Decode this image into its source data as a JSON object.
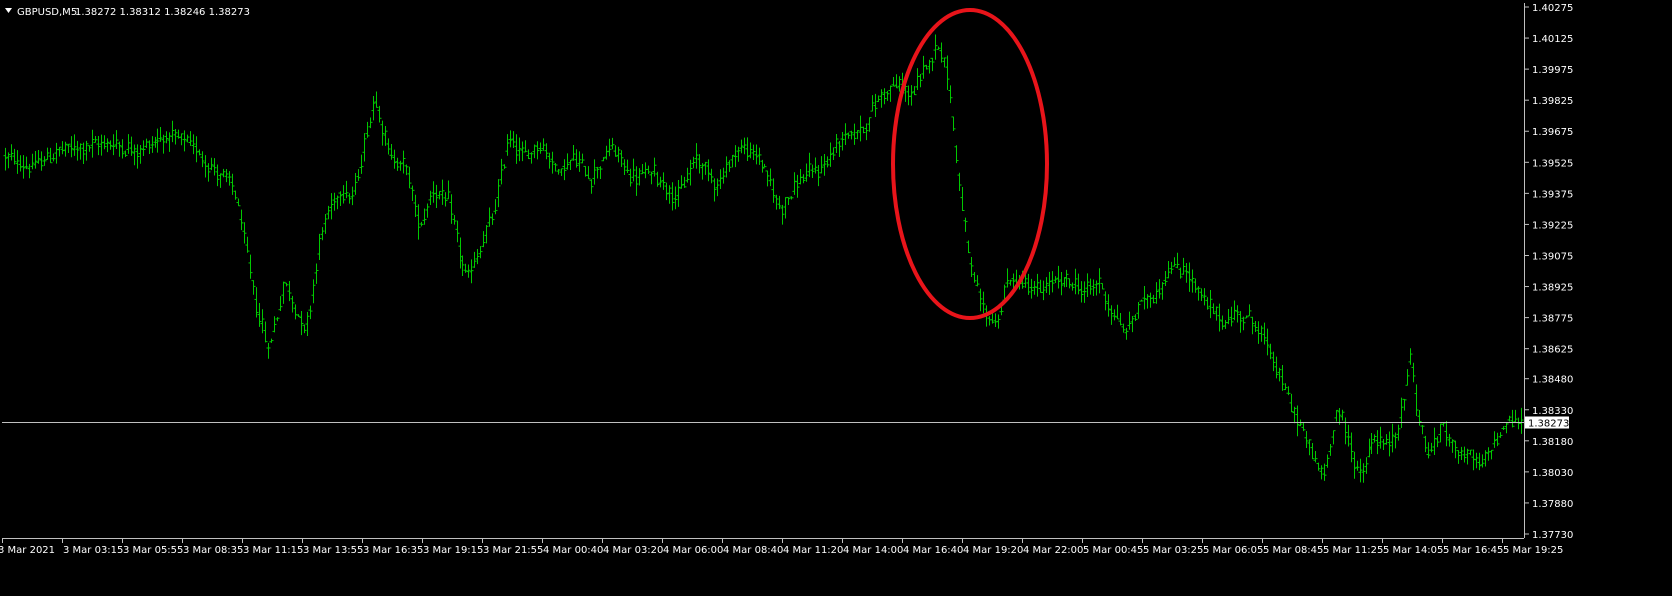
{
  "symbol_info": {
    "symbol": "GBPUSD,M5",
    "ohlc": "1.38272 1.38312 1.38246 1.38273"
  },
  "colors": {
    "background": "#000000",
    "bars": "#00c800",
    "axis": "#c0c0c0",
    "text": "#ffffff",
    "current_price_line": "#c0c0c0",
    "current_price_tag_bg": "#ffffff",
    "annotation": "#e8141a"
  },
  "chart_data": {
    "type": "ohlc",
    "ylim": [
      1.3773,
      1.40275
    ],
    "y_ticks": [
      "1.40275",
      "1.40125",
      "1.39975",
      "1.39825",
      "1.39675",
      "1.39525",
      "1.39375",
      "1.39225",
      "1.39075",
      "1.38925",
      "1.38775",
      "1.38625",
      "1.38480",
      "1.38330",
      "1.38180",
      "1.38030",
      "1.37880",
      "1.37730"
    ],
    "x_ticks": [
      "3 Mar 2021",
      "3 Mar 03:15",
      "3 Mar 05:55",
      "3 Mar 08:35",
      "3 Mar 11:15",
      "3 Mar 13:55",
      "3 Mar 16:35",
      "3 Mar 19:15",
      "3 Mar 21:55",
      "4 Mar 00:40",
      "4 Mar 03:20",
      "4 Mar 06:00",
      "4 Mar 08:40",
      "4 Mar 11:20",
      "4 Mar 14:00",
      "4 Mar 16:40",
      "4 Mar 19:20",
      "4 Mar 22:00",
      "5 Mar 00:45",
      "5 Mar 03:25",
      "5 Mar 06:05",
      "5 Mar 08:45",
      "5 Mar 11:25",
      "5 Mar 14:05",
      "5 Mar 16:45",
      "5 Mar 19:25"
    ],
    "current_price": 1.38273,
    "current_price_label": "1.38273",
    "bar_count": 508,
    "price_path": [
      [
        0,
        1.3955
      ],
      [
        10,
        1.395
      ],
      [
        20,
        1.3958
      ],
      [
        30,
        1.396
      ],
      [
        40,
        1.3962
      ],
      [
        50,
        1.3958
      ],
      [
        60,
        1.3965
      ],
      [
        70,
        1.3962
      ],
      [
        80,
        1.3948
      ],
      [
        87,
        1.394
      ],
      [
        95,
        1.3885
      ],
      [
        100,
        1.3862
      ],
      [
        106,
        1.3895
      ],
      [
        114,
        1.387
      ],
      [
        120,
        1.392
      ],
      [
        127,
        1.394
      ],
      [
        132,
        1.3935
      ],
      [
        140,
        1.3985
      ],
      [
        146,
        1.3955
      ],
      [
        152,
        1.395
      ],
      [
        157,
        1.392
      ],
      [
        162,
        1.394
      ],
      [
        168,
        1.3933
      ],
      [
        175,
        1.3895
      ],
      [
        180,
        1.391
      ],
      [
        186,
        1.393
      ],
      [
        191,
        1.3965
      ],
      [
        197,
        1.3955
      ],
      [
        203,
        1.3962
      ],
      [
        210,
        1.3948
      ],
      [
        216,
        1.3955
      ],
      [
        222,
        1.3945
      ],
      [
        230,
        1.396
      ],
      [
        238,
        1.3945
      ],
      [
        246,
        1.3948
      ],
      [
        255,
        1.3935
      ],
      [
        262,
        1.3955
      ],
      [
        270,
        1.3942
      ],
      [
        278,
        1.396
      ],
      [
        286,
        1.3955
      ],
      [
        294,
        1.393
      ],
      [
        302,
        1.3945
      ],
      [
        310,
        1.395
      ],
      [
        318,
        1.3965
      ],
      [
        325,
        1.3968
      ],
      [
        332,
        1.3985
      ],
      [
        338,
        1.399
      ],
      [
        344,
        1.3985
      ],
      [
        350,
        1.4
      ],
      [
        353,
        1.401
      ],
      [
        357,
        1.4
      ],
      [
        361,
        1.395
      ],
      [
        366,
        1.39
      ],
      [
        371,
        1.388
      ],
      [
        376,
        1.3875
      ],
      [
        380,
        1.3895
      ],
      [
        385,
        1.3895
      ],
      [
        392,
        1.389
      ],
      [
        398,
        1.3895
      ],
      [
        404,
        1.3895
      ],
      [
        410,
        1.389
      ],
      [
        415,
        1.3895
      ],
      [
        420,
        1.388
      ],
      [
        425,
        1.387
      ],
      [
        431,
        1.3885
      ],
      [
        437,
        1.389
      ],
      [
        442,
        1.3902
      ],
      [
        448,
        1.39
      ],
      [
        455,
        1.3885
      ],
      [
        462,
        1.3875
      ],
      [
        468,
        1.388
      ],
      [
        474,
        1.3875
      ],
      [
        480,
        1.386
      ],
      [
        486,
        1.384
      ],
      [
        491,
        1.3825
      ],
      [
        496,
        1.381
      ],
      [
        500,
        1.38
      ],
      [
        505,
        1.3835
      ],
      [
        510,
        1.3815
      ],
      [
        514,
        1.38
      ],
      [
        519,
        1.382
      ],
      [
        524,
        1.3815
      ],
      [
        529,
        1.3825
      ],
      [
        533,
        1.386
      ],
      [
        536,
        1.383
      ],
      [
        540,
        1.381
      ],
      [
        545,
        1.3825
      ],
      [
        550,
        1.3815
      ],
      [
        555,
        1.381
      ],
      [
        560,
        1.3805
      ],
      [
        565,
        1.3818
      ],
      [
        570,
        1.3828
      ],
      [
        575,
        1.3827
      ]
    ],
    "annotation": {
      "type": "ellipse",
      "label": ""
    }
  }
}
